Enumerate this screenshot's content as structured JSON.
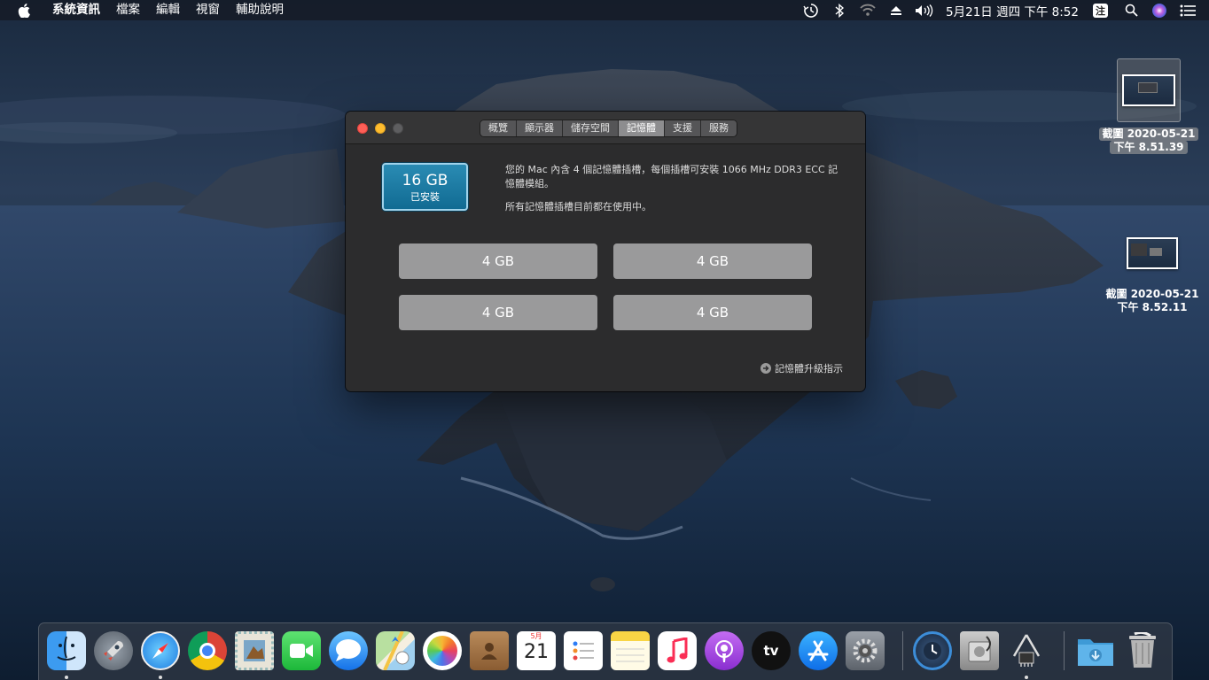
{
  "menubar": {
    "app_name": "系統資訊",
    "menus": [
      "檔案",
      "編輯",
      "視窗",
      "輔助說明"
    ],
    "clock": "5月21日 週四 下午 8:52",
    "input_method": "注"
  },
  "desktop_icons": [
    {
      "line1": "截圖 2020-05-21",
      "line2": "下午 8.51.39",
      "selected": true
    },
    {
      "line1": "截圖 2020-05-21",
      "line2": "下午 8.52.11",
      "selected": false
    }
  ],
  "window": {
    "tabs": [
      "概覽",
      "顯示器",
      "儲存空間",
      "記憶體",
      "支援",
      "服務"
    ],
    "active_tab": "記憶體",
    "installed": {
      "size": "16 GB",
      "label": "已安裝"
    },
    "description": "您的 Mac 內含 4 個記憶體插槽，每個插槽可安裝 1066 MHz DDR3 ECC 記憶體模組。",
    "status": "所有記憶體插槽目前都在使用中。",
    "slots": [
      "4 GB",
      "4 GB",
      "4 GB",
      "4 GB"
    ],
    "upgrade_link": "記憶體升級指示"
  },
  "dock": {
    "items": [
      {
        "name": "finder",
        "running": true
      },
      {
        "name": "launchpad",
        "running": false
      },
      {
        "name": "safari",
        "running": true
      },
      {
        "name": "chrome",
        "running": false
      },
      {
        "name": "mail",
        "running": false
      },
      {
        "name": "facetime",
        "running": false
      },
      {
        "name": "messages",
        "running": false
      },
      {
        "name": "maps",
        "running": false
      },
      {
        "name": "photos",
        "running": false
      },
      {
        "name": "contacts",
        "running": false
      },
      {
        "name": "calendar",
        "running": false,
        "month": "5月",
        "day": "21"
      },
      {
        "name": "reminders",
        "running": false
      },
      {
        "name": "notes",
        "running": false
      },
      {
        "name": "music",
        "running": false
      },
      {
        "name": "podcasts",
        "running": false
      },
      {
        "name": "tv",
        "running": false,
        "label": "tv"
      },
      {
        "name": "app-store",
        "running": false
      },
      {
        "name": "system-preferences",
        "running": false
      },
      {
        "name": "time-machine",
        "running": false
      },
      {
        "name": "disk-utility",
        "running": false
      },
      {
        "name": "system-information",
        "running": true
      },
      {
        "name": "downloads",
        "running": false
      },
      {
        "name": "trash",
        "running": false
      }
    ]
  }
}
